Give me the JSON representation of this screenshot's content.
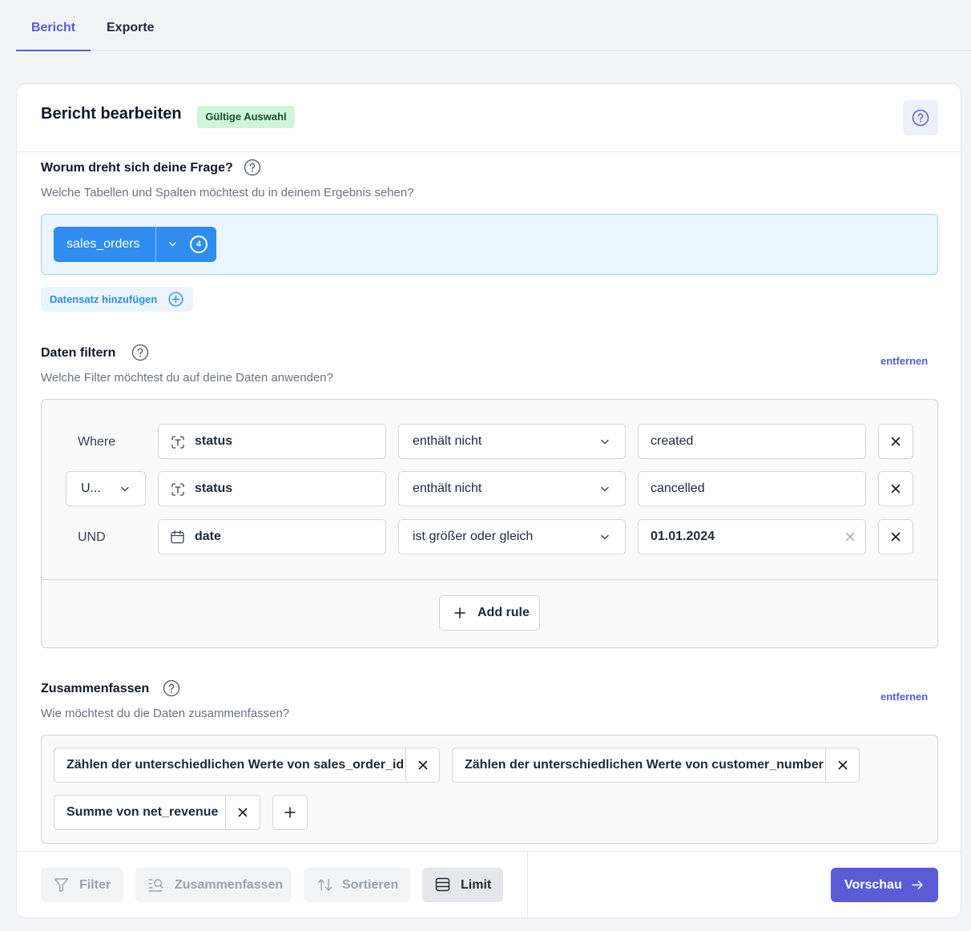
{
  "tabs": [
    {
      "label": "Bericht",
      "active": true
    },
    {
      "label": "Exporte",
      "active": false
    }
  ],
  "header": {
    "title": "Bericht bearbeiten",
    "badge": "Gültige Auswahl"
  },
  "question": {
    "title": "Worum dreht sich deine Frage?",
    "subtitle": "Welche Tabellen und Spalten möchtest du in deinem Ergebnis sehen?",
    "dataset": {
      "name": "sales_orders",
      "count": "4"
    },
    "add_label": "Datensatz hinzufügen"
  },
  "filter": {
    "title": "Daten filtern",
    "subtitle": "Welche Filter möchtest du auf deine Daten anwenden?",
    "remove_label": "entfernen",
    "rows": [
      {
        "conjunction": "Where",
        "field": "status",
        "field_icon": "text-type-icon",
        "operator": "enthält nicht",
        "value": "created"
      },
      {
        "conjunction": "U...",
        "field": "status",
        "field_icon": "text-type-icon",
        "operator": "enthält nicht",
        "value": "cancelled"
      },
      {
        "conjunction": "UND",
        "field": "date",
        "field_icon": "calendar-icon",
        "operator": "ist größer oder gleich",
        "value": "01.01.2024"
      }
    ],
    "add_rule_label": "Add rule"
  },
  "summarize": {
    "title": "Zusammenfassen",
    "subtitle": "Wie möchtest du die Daten zusammenfassen?",
    "remove_label": "entfernen",
    "chips": [
      "Zählen der unterschiedlichen Werte von sales_order_id",
      "Zählen der unterschiedlichen Werte von customer_number",
      "Summe von net_revenue"
    ]
  },
  "footer": {
    "filter_label": "Filter",
    "summarize_label": "Zusammenfassen",
    "sort_label": "Sortieren",
    "limit_label": "Limit",
    "preview_label": "Vorschau"
  },
  "colors": {
    "accent": "#5b5bd6",
    "dataset_blue": "#2f8cf0",
    "badge_green": "#d1f5dc"
  }
}
